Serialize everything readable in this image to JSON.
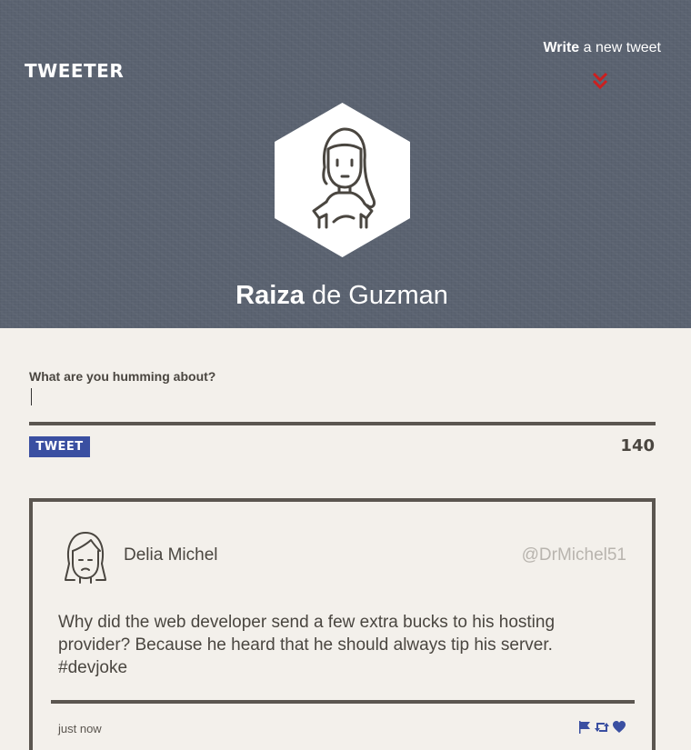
{
  "header": {
    "brand": "TWEETER",
    "write_bold": "Write",
    "write_rest": " a new tweet",
    "chevron_color": "#cc1f1f"
  },
  "profile": {
    "first_name": "Raiza",
    "last_name": " de Guzman",
    "avatar_icon": "woman-portrait-icon"
  },
  "composer": {
    "prompt": "What are you humming about?",
    "value": "",
    "button_label": "TWEET",
    "char_count": "140",
    "button_color": "#3a4fa1"
  },
  "tweets": [
    {
      "author": "Delia Michel",
      "handle": "@DrMichel51",
      "text": "Why did the web developer send a few extra bucks to his hosting provider? Because he heard that he should always tip his server. #devjoke",
      "timestamp": "just now",
      "actions": [
        "flag-icon",
        "retweet-icon",
        "heart-icon"
      ],
      "action_color": "#3a4fa1"
    }
  ]
}
